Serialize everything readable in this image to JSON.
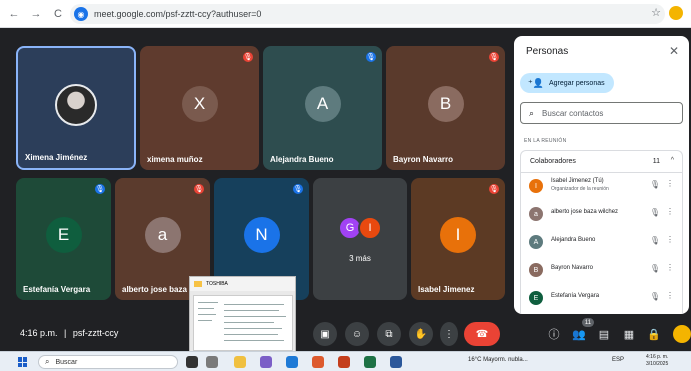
{
  "browser": {
    "url": "meet.google.com/psf-zztt-ccy?authuser=0",
    "nav": {
      "back": "←",
      "forward": "→",
      "reload": "C"
    },
    "bookmark_icon": "☆"
  },
  "tiles": [
    {
      "name": "Ximena Jiménez",
      "kind": "photo",
      "color": "#2c3e5a",
      "active": true
    },
    {
      "name": "ximena muñoz",
      "initial": "X",
      "color": "#5f3b2e",
      "avatar": "#7a5a4e",
      "mute": "#ea4335"
    },
    {
      "name": "Alejandra Bueno",
      "initial": "A",
      "color": "#2e4d4f",
      "avatar": "#5e7b7e",
      "mute": "#1a73e8"
    },
    {
      "name": "Bayron Navarro",
      "initial": "B",
      "color": "#5a3a2c",
      "avatar": "#8a6b60",
      "mute": "#ea4335"
    },
    {
      "name": "Estefanía Vergara",
      "initial": "E",
      "color": "#1e4a38",
      "avatar": "#0f5e3e",
      "mute": "#1a73e8"
    },
    {
      "name": "alberto jose baza",
      "initial": "a",
      "color": "#5b3b2d",
      "avatar": "#8c7570",
      "mute": "#ea4335"
    },
    {
      "name": "",
      "initial": "N",
      "color": "#16405c",
      "avatar": "#1a73e8",
      "mute": "#1a73e8"
    },
    {
      "name": "3 más",
      "kind": "more",
      "color": "#3c4043",
      "letters": [
        "G",
        "I"
      ],
      "letter_colors": [
        "#a142f4",
        "#e8490f"
      ]
    },
    {
      "name": "Isabel Jimenez",
      "initial": "I",
      "color": "#5c3a24",
      "avatar": "#e8710a",
      "mute": "#ea4335"
    }
  ],
  "meeting": {
    "time": "4:16 p.m.",
    "separator": "|",
    "code": "psf-zztt-ccy"
  },
  "controls": {
    "present": "▣",
    "emoji": "☺",
    "captions": "⧉",
    "hand": "✋",
    "more": "⋮",
    "end": "☎"
  },
  "right_controls": {
    "info": "ⓘ",
    "people": "👥",
    "chat": "▤",
    "activities": "▦",
    "lock": "🔒",
    "people_badge": "11"
  },
  "people_panel": {
    "title": "Personas",
    "close": "✕",
    "add_label": "Agregar personas",
    "search_placeholder": "Buscar contactos",
    "section": "EN LA REUNIÓN",
    "group_label": "Colaboradores",
    "group_count": "11",
    "participants": [
      {
        "name": "Isabel Jimenez (Tú)",
        "sub": "Organizador de la reunión",
        "initial": "I",
        "color": "#e8710a"
      },
      {
        "name": "alberto jose baza wilchez",
        "sub": "",
        "initial": "a",
        "color": "#8c7570"
      },
      {
        "name": "Alejandra Bueno",
        "sub": "",
        "initial": "A",
        "color": "#5e7b7e"
      },
      {
        "name": "Bayron Navarro",
        "sub": "",
        "initial": "B",
        "color": "#8a6b60"
      },
      {
        "name": "Estefanía Vergara",
        "sub": "",
        "initial": "E",
        "color": "#0f5e3e"
      }
    ]
  },
  "thumbnail": {
    "title": "TOSHIBA"
  },
  "taskbar": {
    "search_label": "Buscar",
    "weather": "16°C  Mayorm. nubla...",
    "tray": "ESP",
    "time": "4:16 p. m.",
    "date": "3/10/2025"
  }
}
